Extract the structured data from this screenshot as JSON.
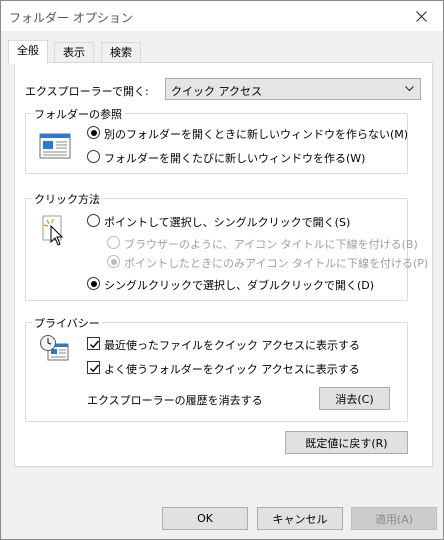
{
  "window": {
    "title": "フォルダー オプション",
    "close_label": "✕"
  },
  "tabs": [
    {
      "label": "全般",
      "active": true
    },
    {
      "label": "表示",
      "active": false
    },
    {
      "label": "検索",
      "active": false
    }
  ],
  "general": {
    "open_explorer_label": "エクスプローラーで開く:",
    "open_explorer_value": "クイック アクセス",
    "browse_folders": {
      "title": "フォルダーの参照",
      "options": [
        {
          "label": "別のフォルダーを開くときに新しいウィンドウを作らない(M)",
          "checked": true
        },
        {
          "label": "フォルダーを開くたびに新しいウィンドウを作る(W)",
          "checked": false
        }
      ]
    },
    "click_items": {
      "title": "クリック方法",
      "options": [
        {
          "label": "ポイントして選択し、シングルクリックで開く(S)",
          "checked": false,
          "disabled": false
        },
        {
          "label": "ブラウザーのように、アイコン タイトルに下線を付ける(B)",
          "checked": false,
          "disabled": true
        },
        {
          "label": "ポイントしたときにのみアイコン タイトルに下線を付ける(P)",
          "checked": true,
          "disabled": true
        },
        {
          "label": "シングルクリックで選択し、ダブルクリックで開く(D)",
          "checked": true,
          "disabled": false
        }
      ]
    },
    "privacy": {
      "title": "プライバシー",
      "checkboxes": [
        {
          "label": "最近使ったファイルをクイック アクセスに表示する",
          "checked": true
        },
        {
          "label": "よく使うフォルダーをクイック アクセスに表示する",
          "checked": true
        }
      ],
      "clear_history_label": "エクスプローラーの履歴を消去する",
      "clear_button": "消去(C)"
    },
    "restore_defaults_button": "既定値に戻す(R)"
  },
  "footer": {
    "ok": "OK",
    "cancel": "キャンセル",
    "apply": "適用(A)"
  },
  "colors": {
    "accent_blue": "#1e6fd1",
    "disabled_text": "#a0a0a0"
  }
}
